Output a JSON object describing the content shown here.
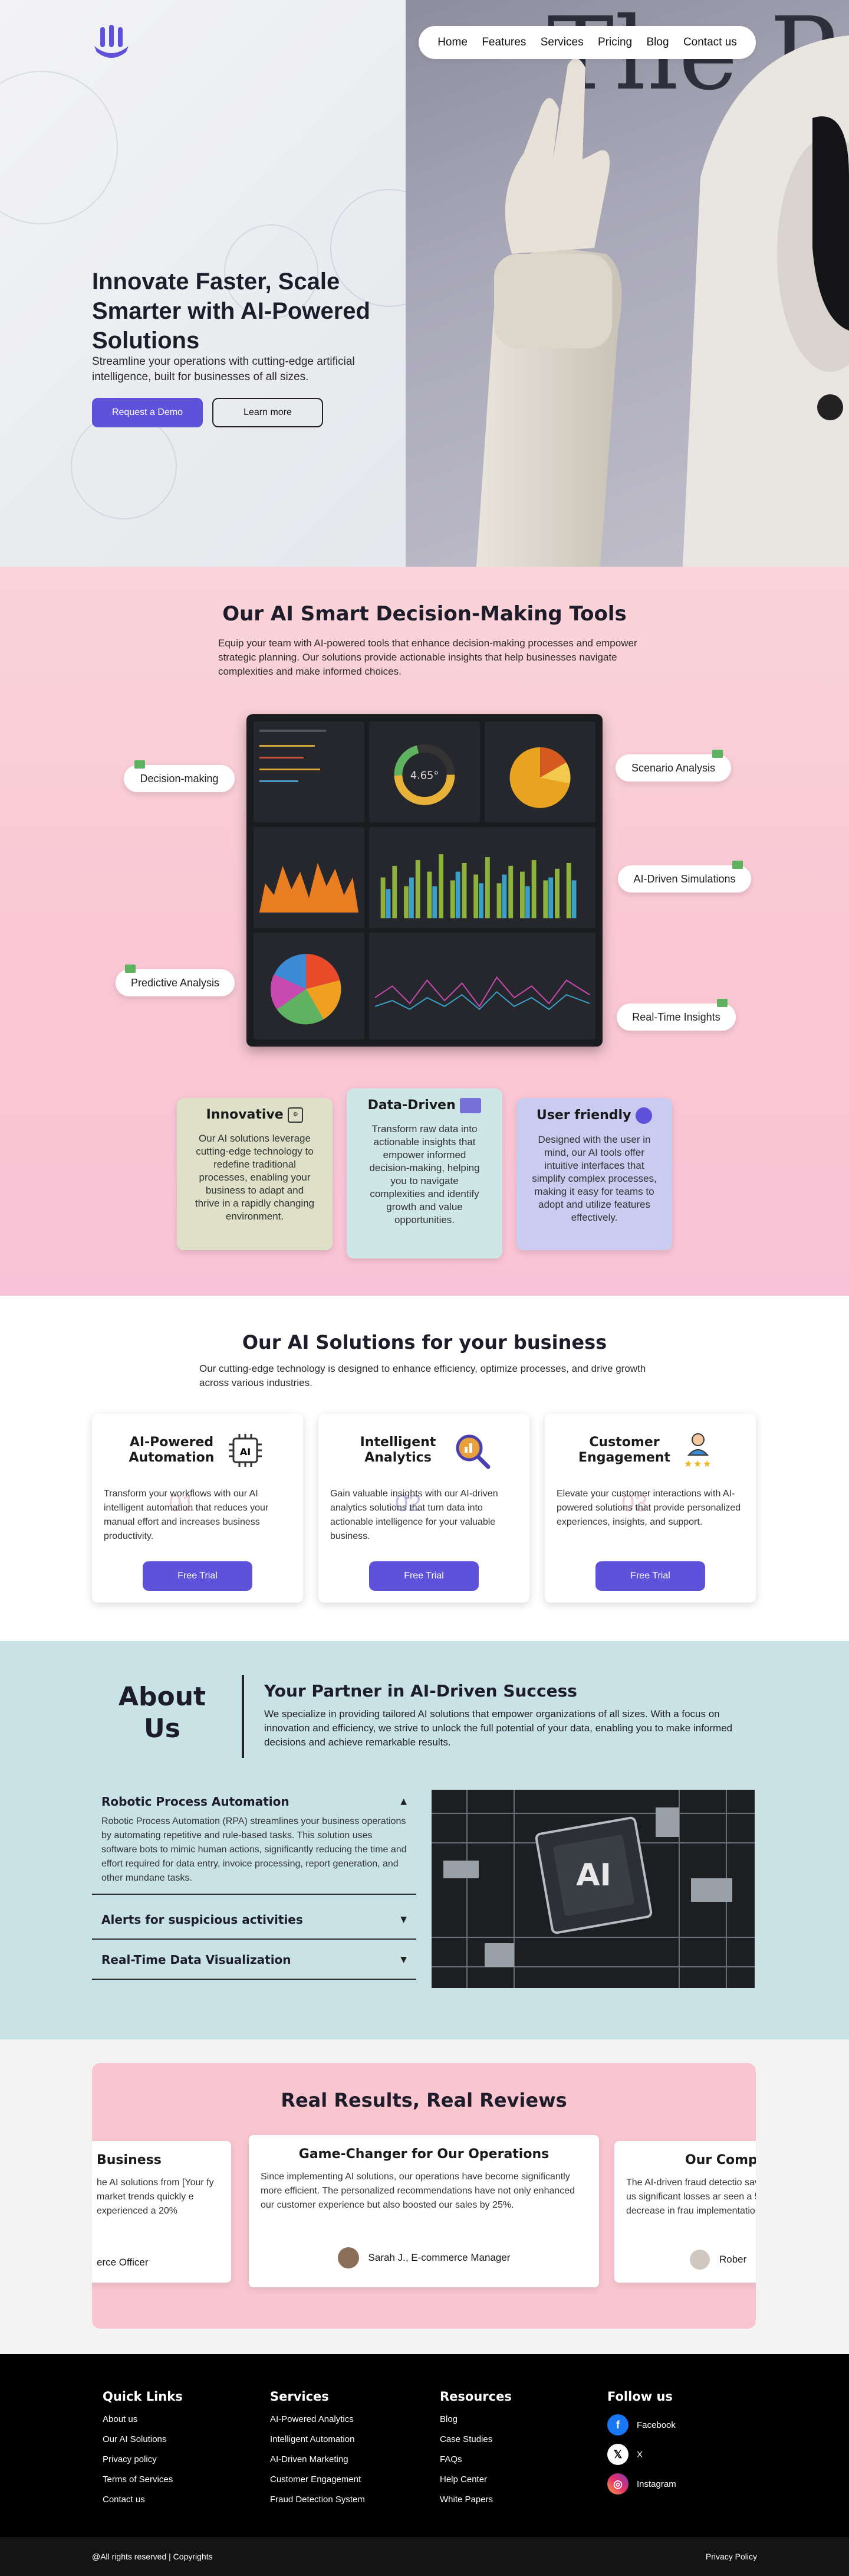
{
  "nav": {
    "items": [
      "Home",
      "Features",
      "Services",
      "Pricing",
      "Blog",
      "Contact us"
    ]
  },
  "hero": {
    "title": "Innovate Faster, Scale Smarter with AI-Powered Solutions",
    "subtitle": "Streamline your operations with cutting-edge artificial intelligence, built for businesses of all sizes.",
    "demo_button": "Request a Demo",
    "learn_button": "Learn more"
  },
  "tools": {
    "title": "Our AI Smart Decision-Making Tools",
    "subtitle": "Equip your team with AI-powered tools that enhance decision-making processes and empower strategic planning. Our solutions provide actionable insights that help businesses navigate complexities and make informed choices.",
    "dashboard_gauge_value": "4.65°",
    "pills": [
      "Decision-making",
      "Scenario Analysis",
      "AI-Driven Simulations",
      "Predictive Analysis",
      "Real-Time Insights"
    ],
    "cards": [
      {
        "title": "Innovative",
        "body": "Our AI solutions leverage cutting-edge technology to redefine traditional processes, enabling your business to adapt and thrive in a rapidly changing environment.",
        "color": "#dfe0c8"
      },
      {
        "title": "Data-Driven",
        "body": "Transform raw data into actionable insights that empower informed decision-making, helping you to navigate complexities and identify growth and value opportunities.",
        "color": "#cfe6e6"
      },
      {
        "title": "User friendly",
        "body": "Designed with the user in mind, our AI tools offer intuitive interfaces that simplify complex processes, making it easy for teams to adopt and utilize features effectively.",
        "color": "#c9cbf0"
      }
    ]
  },
  "solutions": {
    "title": "Our AI Solutions for your business",
    "subtitle": "Our cutting-edge technology is designed to enhance efficiency, optimize processes, and drive growth across various industries.",
    "cards": [
      {
        "title": "AI-Powered Automation",
        "body": "Transform your workflows with our AI intelligent automation that reduces your manual effort and increases business productivity.",
        "button": "Free Trial",
        "watermark": "01"
      },
      {
        "title": "Intelligent Analytics",
        "body": "Gain valuable insights with our AI-driven analytics solutions that turn data into actionable intelligence for your valuable business.",
        "button": "Free Trial",
        "watermark": "02"
      },
      {
        "title": "Customer Engagement",
        "body": "Elevate your customer interactions with AI-powered solutions that provide personalized experiences, insights, and support.",
        "button": "Free Trial",
        "watermark": "03"
      }
    ]
  },
  "about": {
    "title": "About Us",
    "heading": "Your Partner in AI-Driven Success",
    "body": "We specialize in providing tailored AI solutions that empower organizations of all sizes. With a focus on innovation and efficiency, we strive to unlock the full potential of your data, enabling you to make informed decisions and achieve remarkable results.",
    "accordion": [
      {
        "title": "Robotic Process Automation",
        "body": "Robotic Process Automation (RPA) streamlines your business operations by automating repetitive and rule-based tasks. This solution uses software bots to mimic human actions, significantly reducing the time and effort required for data entry, invoice processing, report generation, and other mundane tasks.",
        "open": true
      },
      {
        "title": "Alerts for suspicious activities",
        "open": false
      },
      {
        "title": "Real-Time Data Visualization",
        "open": false
      }
    ],
    "chip_label": "AI"
  },
  "reviews": {
    "title": "Real Results, Real Reviews",
    "cards": [
      {
        "title": "Business",
        "body": "he AI solutions from [Your fy market trends quickly e experienced a 20%",
        "author": "erce Officer"
      },
      {
        "title": "Game-Changer for Our Operations",
        "body": "Since implementing AI solutions, our operations have become significantly more efficient. The personalized recommendations have not only enhanced our customer experience but also boosted our sales by 25%.",
        "author": "Sarah J., E-commerce Manager"
      },
      {
        "title": "Our Compa",
        "body": "The AI-driven fraud detectio saved us significant losses ar seen a 50% decrease in frau implementation.",
        "author": "Rober"
      }
    ]
  },
  "footer": {
    "quick_links": {
      "title": "Quick Links",
      "items": [
        "About us",
        "Our AI Solutions",
        "Privacy policy",
        "Terms of Services",
        "Contact us"
      ]
    },
    "services": {
      "title": "Services",
      "items": [
        "AI-Powered Analytics",
        "Intelligent Automation",
        "AI-Driven Marketing",
        "Customer Engagement",
        "Fraud Detection System"
      ]
    },
    "resources": {
      "title": "Resources",
      "items": [
        "Blog",
        "Case Studies",
        "FAQs",
        "Help Center",
        "White Papers"
      ]
    },
    "follow": {
      "title": "Follow us",
      "items": [
        "Facebook",
        "X",
        "Instagram"
      ]
    },
    "copyright": "@All rights reserved | Copyrights",
    "privacy": "Privacy Policy"
  },
  "colors": {
    "accent": "#5d52d9",
    "tools_bg": "#f9c8d4",
    "about_bg": "#c8e2e6",
    "reviews_box": "#f9c6d0",
    "footer_bg": "#000000"
  }
}
